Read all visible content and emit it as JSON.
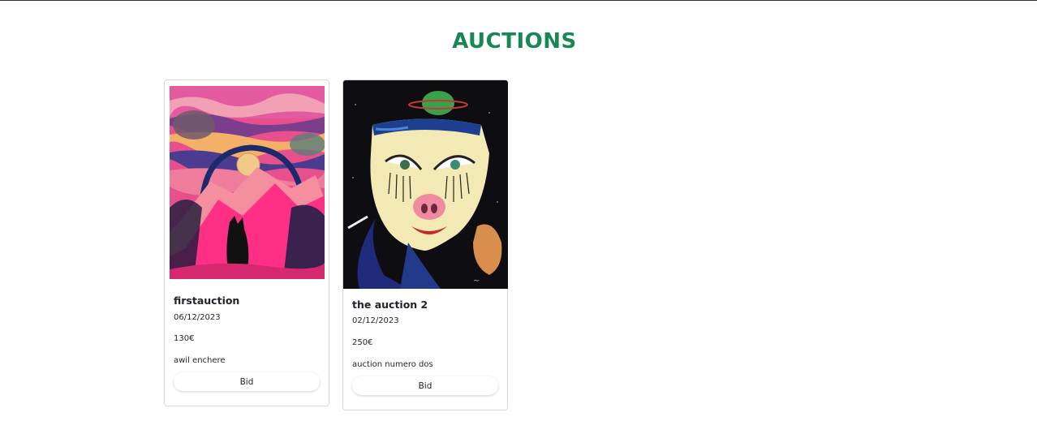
{
  "page": {
    "title": "AUCTIONS",
    "accent_color": "#198754"
  },
  "auctions": [
    {
      "name": "firstauction",
      "date": "06/12/2023",
      "price": "130€",
      "description": "awil enchere",
      "bid_label": "Bid",
      "image": "painting-pink-landscape-black-dog-moon"
    },
    {
      "name": "the auction 2",
      "date": "02/12/2023",
      "price": "250€",
      "description": "auction numero dos",
      "bid_label": "Bid",
      "image": "painting-clown-mask-pig-nose-planet"
    }
  ]
}
